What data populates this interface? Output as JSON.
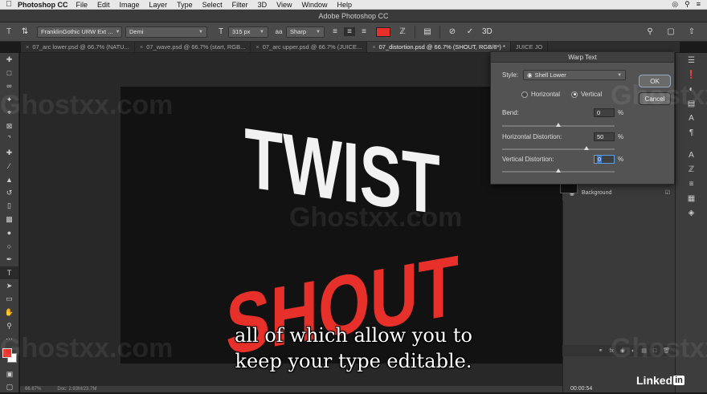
{
  "menubar": {
    "app": "Photoshop CC",
    "items": [
      "File",
      "Edit",
      "Image",
      "Layer",
      "Type",
      "Select",
      "Filter",
      "3D",
      "View",
      "Window",
      "Help"
    ]
  },
  "window_title": "Adobe Photoshop CC",
  "options": {
    "font_family": "FranklinGothic URW Ext ...",
    "font_style": "Demi",
    "font_size": "315 px",
    "antialias": "Sharp",
    "text_color": "#e8302a",
    "size_icon_label": "T",
    "threed_label": "3D"
  },
  "tabs": [
    "07_arc lower.psd @ 66.7% (NATU...",
    "07_wave.psd @ 66.7% (start, RGB...",
    "07_arc upper.psd @ 66.7% (JUICE...",
    "07_distortion.psd @ 66.7% (SHOUT, RGB/8*) *",
    "JUICE JO"
  ],
  "canvas": {
    "word1": "TWIST",
    "word2": "SHOUT",
    "word1_color": "#f2f2f2",
    "word2_color": "#e8302a"
  },
  "dialog": {
    "title": "Warp Text",
    "style_label": "Style:",
    "style_value": "Shell Lower",
    "horizontal_label": "Horizontal",
    "vertical_label": "Vertical",
    "ok": "OK",
    "cancel": "Cancel",
    "bend_label": "Bend:",
    "bend_value": "0",
    "hdist_label": "Horizontal Distortion:",
    "hdist_value": "50",
    "vdist_label": "Vertical Distortion:",
    "vdist_value": "0",
    "percent": "%"
  },
  "layers": {
    "background_name": "Background"
  },
  "status": {
    "zoom": "66.67%",
    "doc": "Doc: 2.93M/23.7M"
  },
  "watermark": "Ghostxx.com",
  "subtitle_line1": "all of which allow you to",
  "subtitle_line2": "keep your type editable.",
  "brand": {
    "linked": "Linked",
    "in": "in"
  },
  "timecode": "00:00:54"
}
